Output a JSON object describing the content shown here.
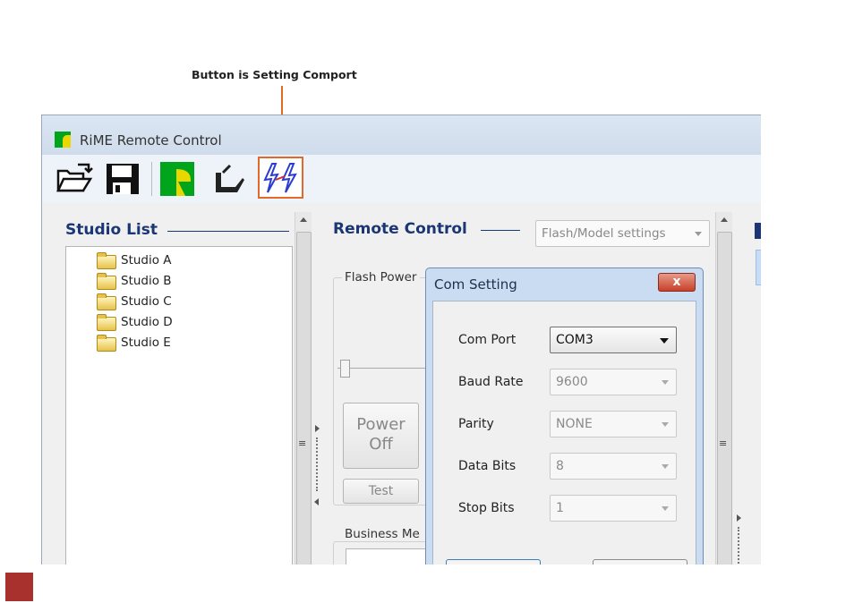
{
  "annotation": {
    "text": "Button is Setting Comport",
    "color": "#e06a2a"
  },
  "window": {
    "title": "RiME Remote Control",
    "icon": "rime-logo-icon"
  },
  "toolbar": {
    "buttons": [
      {
        "name": "open-folder-icon"
      },
      {
        "name": "save-disk-icon"
      },
      {
        "name": "studio-logo-icon"
      },
      {
        "name": "flash-light-icon"
      },
      {
        "name": "com-setting-icon"
      }
    ]
  },
  "studio_list": {
    "title": "Studio List",
    "items": [
      "Studio A",
      "Studio B",
      "Studio C",
      "Studio D",
      "Studio E"
    ]
  },
  "remote_control": {
    "title": "Remote Control",
    "mode_select": "Flash/Model settings",
    "flash_power_label": "Flash Power",
    "power_button_line1": "Power",
    "power_button_line2": "Off",
    "test_button": "Test",
    "business_label": "Business Me"
  },
  "com_setting": {
    "title": "Com Setting",
    "close_label": "x",
    "fields": [
      {
        "label": "Com Port",
        "value": "COM3",
        "enabled": true
      },
      {
        "label": "Baud Rate",
        "value": "9600",
        "enabled": false
      },
      {
        "label": "Parity",
        "value": "NONE",
        "enabled": false
      },
      {
        "label": "Data Bits",
        "value": "8",
        "enabled": false
      },
      {
        "label": "Stop Bits",
        "value": "1",
        "enabled": false
      }
    ]
  },
  "colors": {
    "section_title": "#1b3675",
    "highlight": "#e06a2a",
    "dialog_frame": "#c9dcf1",
    "swatch": "#a8312d"
  }
}
